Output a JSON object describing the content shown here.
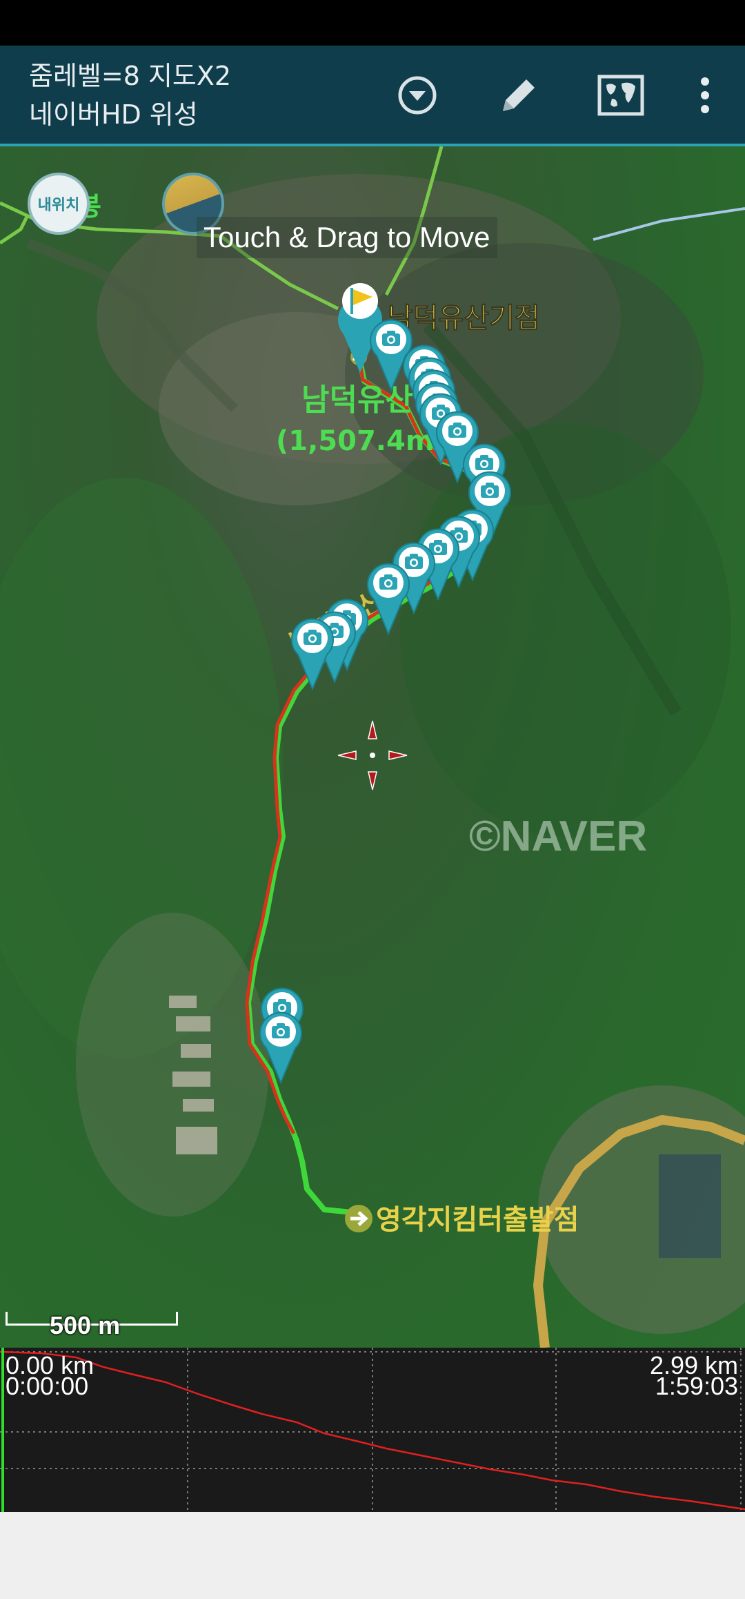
{
  "app_bar": {
    "title_line_1": "줌레벨=8 지도X2",
    "title_line_2": "네이버HD 위성",
    "buttons": [
      {
        "name": "dropdown",
        "icon": "chevron-down-circle-icon"
      },
      {
        "name": "edit",
        "icon": "pencil-icon"
      },
      {
        "name": "map",
        "icon": "world-map-icon"
      },
      {
        "name": "more",
        "icon": "more-vertical-icon"
      }
    ]
  },
  "map": {
    "drag_hint": "Touch & Drag to Move",
    "my_location_label": "내위치",
    "place_labels": {
      "peak_name_partial": "남덕유산",
      "peak_elevation_partial": "(1,507.4m",
      "start_point": "남덕유산기점",
      "trail_start": "영각지킴터출발점",
      "trail_name_fragment": "남덕유산 영각",
      "bong_fragment": "봉"
    },
    "watermark": "©NAVER",
    "scale_label": "500 m",
    "colors": {
      "track_red": "#d8321e",
      "track_green": "#3fd83a",
      "marker_teal": "#2aa3b4",
      "label_yellow": "#e8d24a"
    }
  },
  "profile": {
    "start_distance": "0.00 km",
    "start_time": "0:00:00",
    "end_distance": "2.99 km",
    "end_time": "1:59:03",
    "colors": {
      "line": "#e02020",
      "cursor": "#2ee02e",
      "grid": "#9a9a9a"
    }
  }
}
